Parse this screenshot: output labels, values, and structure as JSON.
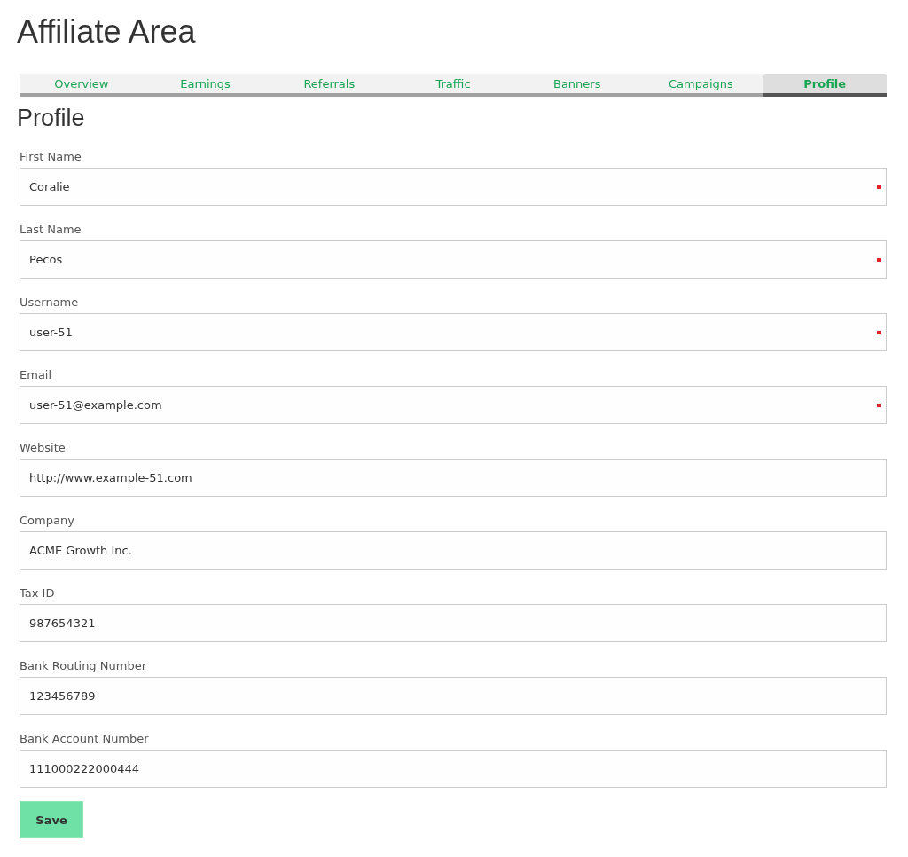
{
  "page_title": "Affiliate Area",
  "tabs": [
    {
      "label": "Overview",
      "selected": false
    },
    {
      "label": "Earnings",
      "selected": false
    },
    {
      "label": "Referrals",
      "selected": false
    },
    {
      "label": "Traffic",
      "selected": false
    },
    {
      "label": "Banners",
      "selected": false
    },
    {
      "label": "Campaigns",
      "selected": false
    },
    {
      "label": "Profile",
      "selected": true
    }
  ],
  "section_title": "Profile",
  "fields": [
    {
      "label": "First Name",
      "value": "Coralie",
      "required": true
    },
    {
      "label": "Last Name",
      "value": "Pecos",
      "required": true
    },
    {
      "label": "Username",
      "value": "user-51",
      "required": true
    },
    {
      "label": "Email",
      "value": "user-51@example.com",
      "required": true
    },
    {
      "label": "Website",
      "value": "http://www.example-51.com",
      "required": false
    },
    {
      "label": "Company",
      "value": "ACME Growth Inc.",
      "required": false
    },
    {
      "label": "Tax ID",
      "value": "987654321",
      "required": false
    },
    {
      "label": "Bank Routing Number",
      "value": "123456789",
      "required": false
    },
    {
      "label": "Bank Account Number",
      "value": "111000222000444",
      "required": false
    }
  ],
  "save_button": "Save"
}
